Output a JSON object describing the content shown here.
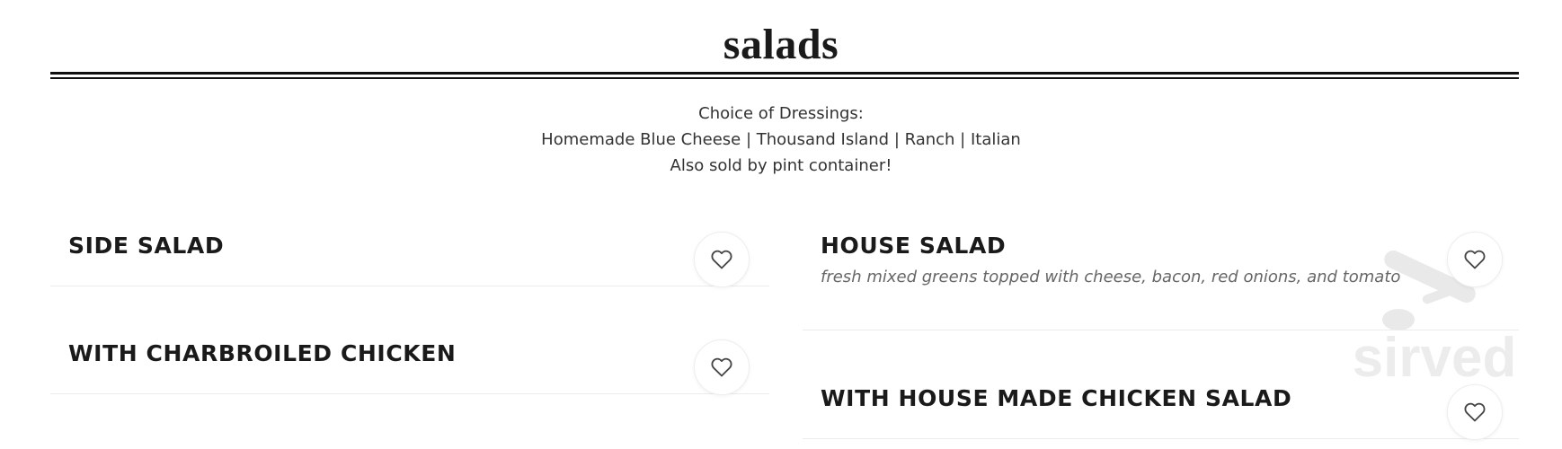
{
  "section": {
    "title": "salads"
  },
  "dressings": {
    "line1": "Choice of Dressings:",
    "line2": "Homemade Blue Cheese | Thousand Island | Ranch | Italian",
    "line3": "Also sold by pint container!"
  },
  "items": [
    {
      "name": "SIDE SALAD",
      "description": ""
    },
    {
      "name": "WITH CHARBROILED CHICKEN",
      "description": ""
    },
    {
      "name": "HOUSE SALAD",
      "description": "fresh mixed greens topped with cheese, bacon, red onions, and tomato"
    },
    {
      "name": "WITH HOUSE MADE CHICKEN SALAD",
      "description": ""
    }
  ],
  "watermark": {
    "text": "sirved",
    "icon": "utensils-icon"
  },
  "icons": {
    "favorite": "heart-icon"
  },
  "colors": {
    "text": "#1a1a1a",
    "muted": "#666666",
    "rule": "#111111"
  }
}
